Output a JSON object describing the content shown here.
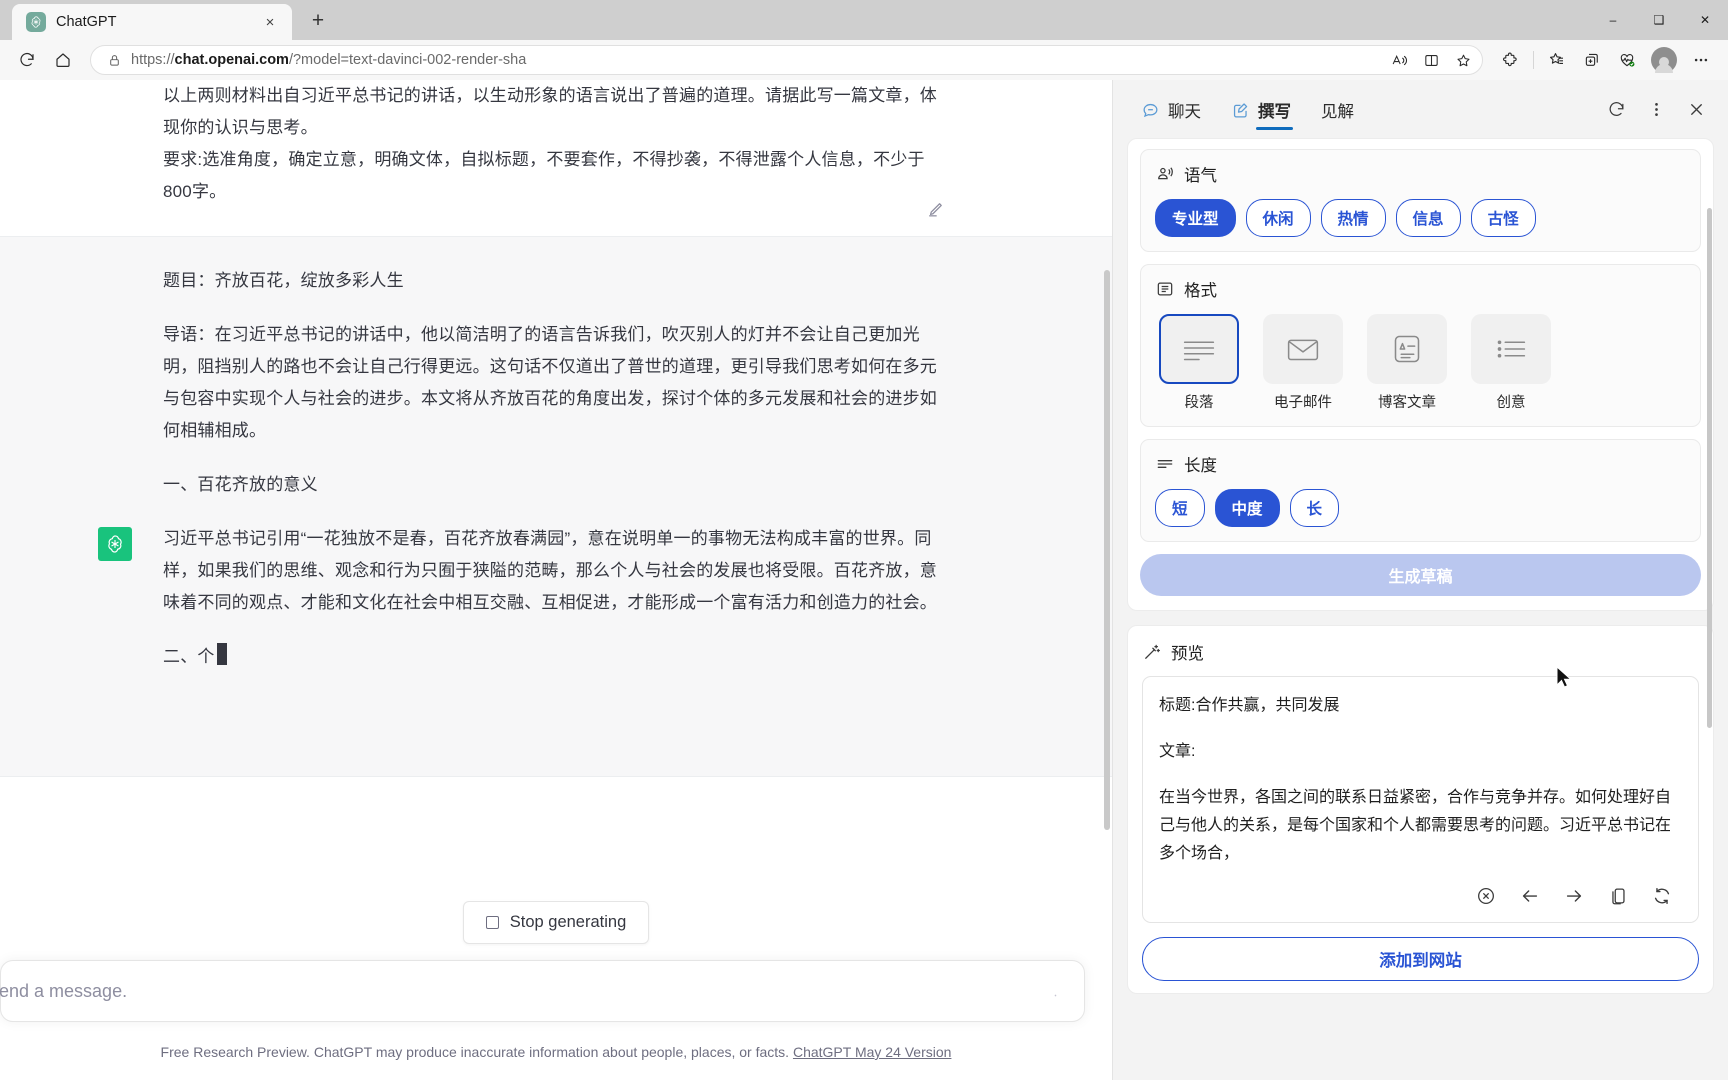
{
  "browser": {
    "tab": {
      "title": "ChatGPT",
      "favicon": "openai-logo-icon",
      "close": "×"
    },
    "new_tab": "+",
    "window_controls": {
      "minimize": "–",
      "maximize": "❑",
      "close": "✕"
    },
    "nav": {
      "reload": "reload-icon",
      "home": "home-icon"
    },
    "omnibox": {
      "lock": "lock-icon",
      "url_prefix": "https://",
      "url_host": "chat.openai.com",
      "url_suffix": "/?model=text-davinci-002-render-sha",
      "full_url": "https://chat.openai.com/?model=text-davinci-002-render-sha",
      "read_aloud": "read-aloud-icon",
      "split_screen": "split-screen-icon",
      "favorite": "star-icon"
    },
    "toolbar_right": {
      "extensions": "extensions-puzzle-icon",
      "collections": "collections-icon",
      "add_tab_group": "add-tab-group-icon",
      "performance": "performance-heart-icon",
      "profile": "profile-avatar-icon",
      "settings": "more-settings-icon"
    }
  },
  "chat": {
    "user_message": {
      "line1": "以上两则材料出自习近平总书记的讲话，以生动形象的语言说出了普遍的道理。请据此写一篇文章，体现你的认识与思考。",
      "line2": "要求:选准角度，确定立意，明确文体，自拟标题，不要套作，不得抄袭，不得泄露个人信息，不少于800字。",
      "edit_icon": "edit-pencil-icon"
    },
    "ai_message": {
      "avatar": "openai-logo-icon",
      "title": "题目：齐放百花，绽放多彩人生",
      "intro": "导语：在习近平总书记的讲话中，他以简洁明了的语言告诉我们，吹灭别人的灯并不会让自己更加光明，阻挡别人的路也不会让自己行得更远。这句话不仅道出了普世的道理，更引导我们思考如何在多元与包容中实现个人与社会的进步。本文将从齐放百花的角度出发，探讨个体的多元发展和社会的进步如何相辅相成。",
      "heading1": "一、百花齐放的意义",
      "body1": "习近平总书记引用“一花独放不是春，百花齐放春满园”，意在说明单一的事物无法构成丰富的世界。同样，如果我们的思维、观念和行为只囿于狭隘的范畴，那么个人与社会的发展也将受限。百花齐放，意味着不同的观点、才能和文化在社会中相互交融、互相促进，才能形成一个富有活力和创造力的社会。",
      "heading2_partial": "二、个"
    },
    "stop_button": {
      "label": "Stop generating",
      "icon": "stop-square-icon"
    },
    "composer": {
      "placeholder_visible": "end a message.",
      "send_icon": "send-icon"
    },
    "footer": {
      "text": "Free Research Preview. ChatGPT may produce inaccurate information about people, places, or facts.",
      "link": "ChatGPT May 24 Version"
    }
  },
  "sidebar": {
    "tabs": [
      {
        "label": "聊天",
        "icon": "chat-bubble-icon",
        "active": false
      },
      {
        "label": "撰写",
        "icon": "compose-pencil-icon",
        "active": true
      },
      {
        "label": "见解",
        "icon": "insights-icon",
        "active": false
      }
    ],
    "head_actions": {
      "refresh": "refresh-icon",
      "more": "more-vertical-icon",
      "close": "close-icon"
    },
    "tone": {
      "title": "语气",
      "icon": "tone-speech-icon",
      "options": [
        {
          "label": "专业型",
          "selected": true
        },
        {
          "label": "休闲",
          "selected": false
        },
        {
          "label": "热情",
          "selected": false
        },
        {
          "label": "信息",
          "selected": false
        },
        {
          "label": "古怪",
          "selected": false
        }
      ]
    },
    "format": {
      "title": "格式",
      "icon": "format-list-icon",
      "options": [
        {
          "label": "段落",
          "icon": "paragraph-icon",
          "selected": true
        },
        {
          "label": "电子邮件",
          "icon": "email-icon",
          "selected": false
        },
        {
          "label": "博客文章",
          "icon": "blog-post-icon",
          "selected": false
        },
        {
          "label": "创意",
          "icon": "ideas-list-icon",
          "selected": false
        }
      ]
    },
    "length": {
      "title": "长度",
      "icon": "length-lines-icon",
      "options": [
        {
          "label": "短",
          "selected": false
        },
        {
          "label": "中度",
          "selected": true
        },
        {
          "label": "长",
          "selected": false
        }
      ]
    },
    "generate_button": {
      "label": "生成草稿",
      "disabled": true
    },
    "preview": {
      "title": "预览",
      "icon": "magic-wand-icon",
      "lines": [
        "标题:合作共赢，共同发展",
        "文章:",
        "在当今世界，各国之间的联系日益紧密，合作与竞争并存。如何处理好自己与他人的关系，是每个国家和个人都需要思考的问题。习近平总书记在多个场合，"
      ],
      "actions": [
        {
          "icon": "dismiss-circle-icon",
          "name": "dismiss"
        },
        {
          "icon": "arrow-left-icon",
          "name": "previous"
        },
        {
          "icon": "arrow-right-icon",
          "name": "next"
        },
        {
          "icon": "copy-icon",
          "name": "copy"
        },
        {
          "icon": "regenerate-icon",
          "name": "regenerate"
        }
      ]
    },
    "add_to_site_button": {
      "label": "添加到网站"
    }
  },
  "colors": {
    "accent_blue": "#2a54d4",
    "tab_underline": "#0f6cbd",
    "openai_green": "#19c37d",
    "disabled_button": "#bac7ef"
  }
}
